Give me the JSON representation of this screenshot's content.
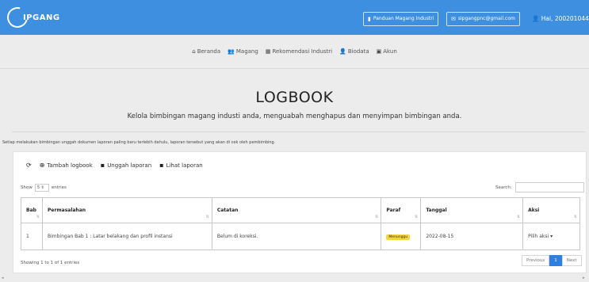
{
  "header": {
    "brand": "IPGANG",
    "guide_button": "Panduan Magang Industri",
    "email_button": "sipgangpnc@gmail.com",
    "user_greeting": "Hai, 200201044"
  },
  "nav": {
    "items": [
      {
        "label": "Beranda",
        "icon": "home-icon"
      },
      {
        "label": "Magang",
        "icon": "users-icon"
      },
      {
        "label": "Rekomendasi Industri",
        "icon": "building-icon"
      },
      {
        "label": "Biodata",
        "icon": "user-icon"
      },
      {
        "label": "Akun",
        "icon": "id-card-icon"
      }
    ]
  },
  "hero": {
    "title": "LOGBOOK",
    "subtitle": "Kelola bimbingan magang industi anda, menguabah menghapus dan menyimpan bimbingan anda."
  },
  "notice": "Setiap melakukan bimbingan unggah dokumen laporan paling baru terlebih dahulu, laporan tersebut yang akan di cek oleh pembimbing.",
  "toolbar": {
    "refresh_icon": "refresh-icon",
    "add_label": "Tambah logbook",
    "upload_label": "Unggah laporan",
    "view_label": "Lihat laporan"
  },
  "table_controls": {
    "show_label": "Show",
    "show_value": "5",
    "entries_label": "entries",
    "search_label": "Search:"
  },
  "table": {
    "columns": [
      "Bab",
      "Permasalahan",
      "Catatan",
      "Paraf",
      "Tanggal",
      "Aksi"
    ],
    "rows": [
      {
        "bab": "1",
        "permasalahan": "Bimbingan Bab 1 : Latar belakang dan profil instansi",
        "catatan": "Belum di koreksi.",
        "paraf": "Menunggu",
        "tanggal": "2022-08-15",
        "aksi": "Pilih aksi ▾"
      }
    ]
  },
  "footer": {
    "info": "Showing 1 to 1 of 1 entries",
    "previous": "Previous",
    "page": "1",
    "next": "Next"
  },
  "colors": {
    "topbar": "#3f8fe0",
    "badge": "#f5d63c",
    "active_page": "#2d7fe3"
  }
}
